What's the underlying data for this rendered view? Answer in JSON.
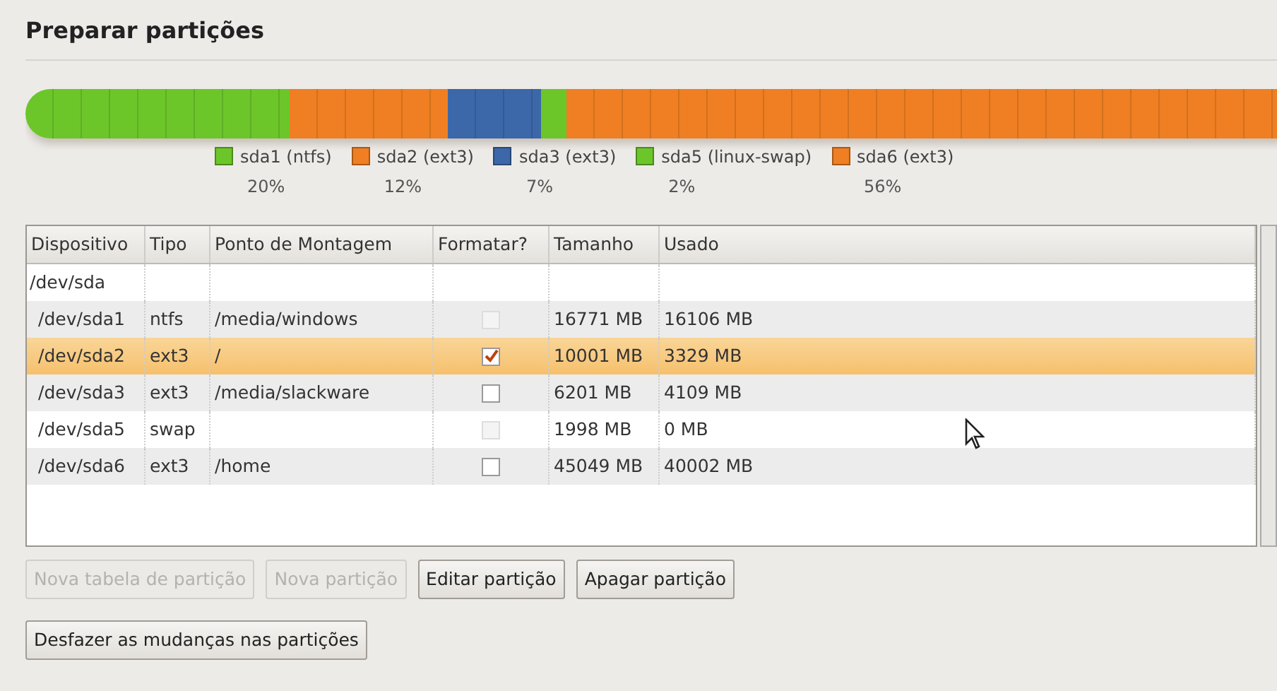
{
  "title": "Preparar partições",
  "partitions": [
    {
      "name": "sda1 (ntfs)",
      "percent": "20%",
      "color": "#6cc62a"
    },
    {
      "name": "sda2 (ext3)",
      "percent": "12%",
      "color": "#ef7f22"
    },
    {
      "name": "sda3 (ext3)",
      "percent": "7%",
      "color": "#3c67a8"
    },
    {
      "name": "sda5 (linux-swap)",
      "percent": "2%",
      "color": "#6cc62a"
    },
    {
      "name": "sda6 (ext3)",
      "percent": "56%",
      "color": "#ef7f22"
    }
  ],
  "table": {
    "columns": [
      "Dispositivo",
      "Tipo",
      "Ponto de Montagem",
      "Formatar?",
      "Tamanho",
      "Usado"
    ],
    "rows": [
      {
        "device": "/dev/sda",
        "selected": false,
        "children": [
          {
            "device": "/dev/sda1",
            "type": "ntfs",
            "mount": "/media/windows",
            "format": {
              "checked": false,
              "disabled": true
            },
            "size": "16771 MB",
            "used": "16106 MB",
            "selected": false
          },
          {
            "device": "/dev/sda2",
            "type": "ext3",
            "mount": "/",
            "format": {
              "checked": true,
              "disabled": false
            },
            "size": "10001 MB",
            "used": "3329 MB",
            "selected": true
          },
          {
            "device": "/dev/sda3",
            "type": "ext3",
            "mount": "/media/slackware",
            "format": {
              "checked": false,
              "disabled": false
            },
            "size": "6201 MB",
            "used": "4109 MB",
            "selected": false
          },
          {
            "device": "/dev/sda5",
            "type": "swap",
            "format": {
              "checked": false,
              "disabled": true
            },
            "size": "1998 MB",
            "used": "0 MB",
            "selected": false
          },
          {
            "device": "/dev/sda6",
            "type": "ext3",
            "mount": "/home",
            "format": {
              "checked": false,
              "disabled": false
            },
            "size": "45049 MB",
            "used": "40002 MB",
            "selected": false
          }
        ]
      }
    ]
  },
  "buttons": [
    {
      "label": "Nova tabela de partição",
      "disabled": true
    },
    {
      "label": "Nova partição",
      "disabled": true
    },
    {
      "label": "Editar partição",
      "disabled": false
    },
    {
      "label": "Apagar partição",
      "disabled": false
    },
    {
      "label": "Desfazer as mudanças nas partições",
      "disabled": false
    }
  ]
}
